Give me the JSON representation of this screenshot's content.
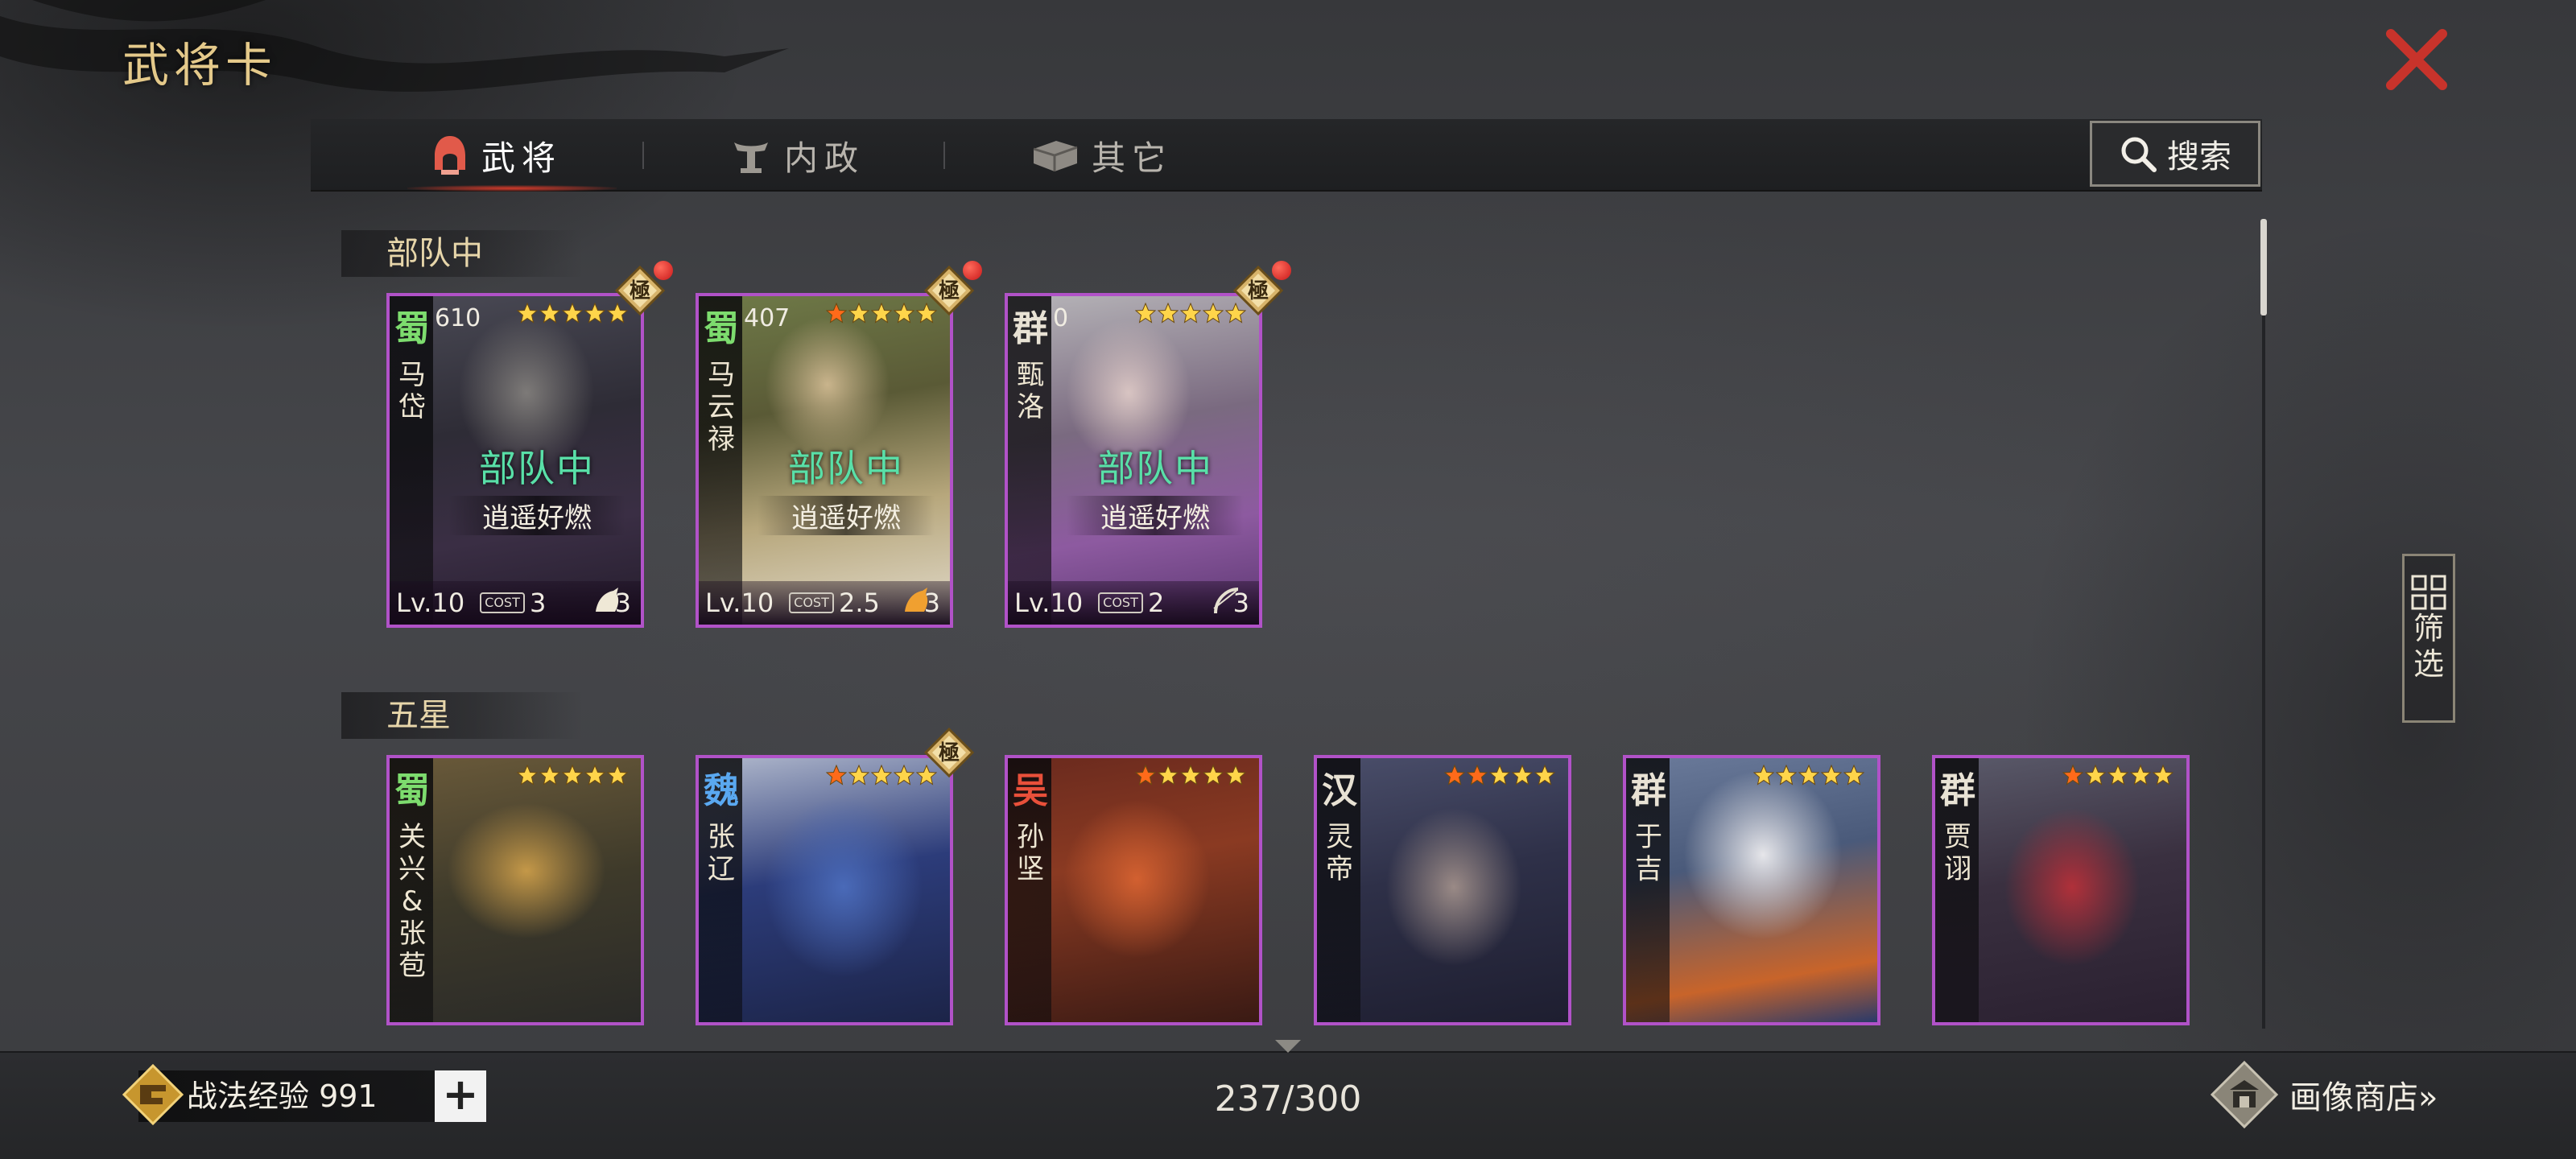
{
  "title": "武将卡",
  "tabs": [
    {
      "label": "武将",
      "active": true
    },
    {
      "label": "内政",
      "active": false
    },
    {
      "label": "其它",
      "active": false
    }
  ],
  "search_label": "搜索",
  "filter_label": [
    "筛",
    "选"
  ],
  "sections": [
    {
      "title": "部队中"
    },
    {
      "title": "五星"
    }
  ],
  "in_team_cards": [
    {
      "faction": "蜀",
      "faction_color": "#7ddc6e",
      "count": "610",
      "name": [
        "马",
        "岱"
      ],
      "stars": 5,
      "red_stars": 0,
      "status": "部队中",
      "team": "逍遥好燃",
      "lv": "Lv.10",
      "cost": "3",
      "troop": "3",
      "troop_icon": "cavalry-icon"
    },
    {
      "faction": "蜀",
      "faction_color": "#7ddc6e",
      "count": "407",
      "name": [
        "马",
        "云",
        "禄"
      ],
      "stars": 5,
      "red_stars": 1,
      "status": "部队中",
      "team": "逍遥好燃",
      "lv": "Lv.10",
      "cost": "2.5",
      "troop": "3",
      "troop_icon": "cavalry-icon"
    },
    {
      "faction": "群",
      "faction_color": "#e8e2d4",
      "count": "0",
      "name": [
        "甄",
        "洛"
      ],
      "stars": 5,
      "red_stars": 0,
      "status": "部队中",
      "team": "逍遥好燃",
      "lv": "Lv.10",
      "cost": "2",
      "troop": "3",
      "troop_icon": "archer-icon"
    }
  ],
  "five_star_cards": [
    {
      "faction": "蜀",
      "faction_color": "#7ddc6e",
      "name": [
        "关",
        "兴",
        "&",
        "张",
        "苞"
      ],
      "stars": 5,
      "red_stars": 0
    },
    {
      "faction": "魏",
      "faction_color": "#5aa8f0",
      "name": [
        "张",
        "辽"
      ],
      "stars": 5,
      "red_stars": 1
    },
    {
      "faction": "吴",
      "faction_color": "#e8503a",
      "name": [
        "孙",
        "坚"
      ],
      "stars": 5,
      "red_stars": 1
    },
    {
      "faction": "汉",
      "faction_color": "#e8e2d4",
      "name": [
        "灵",
        "帝"
      ],
      "stars": 5,
      "red_stars": 2
    },
    {
      "faction": "群",
      "faction_color": "#e8e2d4",
      "name": [
        "于",
        "吉"
      ],
      "stars": 5,
      "red_stars": 0
    },
    {
      "faction": "群",
      "faction_color": "#e8e2d4",
      "name": [
        "贾",
        "诩"
      ],
      "stars": 5,
      "red_stars": 1
    }
  ],
  "badge_label": "極",
  "cost_label": "COST",
  "exp_label": "战法经验 991",
  "plus_label": "+",
  "card_count": "237/300",
  "shop_label": "画像商店»",
  "colors": {
    "card_border": "#b152c8",
    "accent_red": "#d13a2a",
    "status_green": "#59e0a8",
    "gold": "#e4c98a"
  }
}
